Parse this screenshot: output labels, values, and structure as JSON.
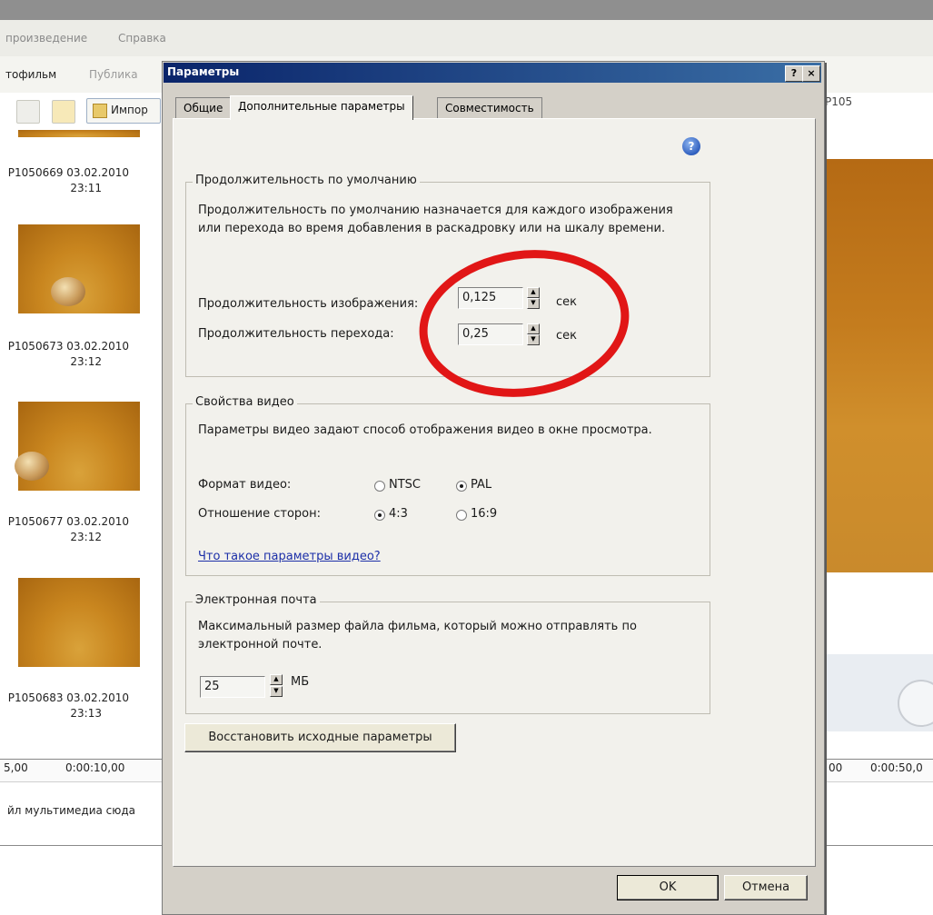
{
  "app": {
    "menu": [
      "произведение",
      "Справка"
    ],
    "toolbar": {
      "movie_label": "тофильм",
      "publish_label": "Публика",
      "import_label": "Импор"
    },
    "collection": [
      {
        "name": "P1050669 03.02.2010",
        "time": "23:11"
      },
      {
        "name": "P1050673 03.02.2010",
        "time": "23:12"
      },
      {
        "name": "P1050677 03.02.2010",
        "time": "23:12"
      },
      {
        "name": "P1050683 03.02.2010",
        "time": "23:13"
      }
    ],
    "timeline": {
      "left_start": "5,00",
      "left_mark": "0:00:10,00",
      "right_start": "00",
      "right_mark": "0:00:50,0",
      "drop_hint": "йл мультимедиа сюда"
    },
    "preview": {
      "header": "P105"
    }
  },
  "dialog": {
    "title": "Параметры",
    "title_buttons": {
      "help": "?",
      "close": "×"
    },
    "tabs": [
      {
        "label": "Общие",
        "active": false
      },
      {
        "label": "Дополнительные параметры",
        "active": true
      },
      {
        "label": "Совместимость",
        "active": false
      }
    ],
    "help_icon": "question-icon",
    "duration": {
      "legend": "Продолжительность по умолчанию",
      "description": "Продолжительность по умолчанию назначается для каждого изображения или перехода во время добавления в раскадровку или на шкалу времени.",
      "image_label": "Продолжительность изображения:",
      "image_value": "0,125",
      "transition_label": "Продолжительность перехода:",
      "transition_value": "0,25",
      "unit": "сек"
    },
    "video": {
      "legend": "Свойства видео",
      "description": "Параметры видео задают способ отображения видео в окне просмотра.",
      "format_label": "Формат видео:",
      "format_options": [
        {
          "label": "NTSC",
          "selected": false
        },
        {
          "label": "PAL",
          "selected": true
        }
      ],
      "aspect_label": "Отношение сторон:",
      "aspect_options": [
        {
          "label": "4:3",
          "selected": true
        },
        {
          "label": "16:9",
          "selected": false
        }
      ],
      "help_link": "Что такое параметры видео?"
    },
    "email": {
      "legend": "Электронная почта",
      "description": "Максимальный размер файла фильма, который можно отправлять по электронной почте.",
      "size_value": "25",
      "unit": "МБ"
    },
    "restore_button": "Восстановить исходные параметры",
    "ok_button": "OK",
    "cancel_button": "Отмена"
  },
  "colors": {
    "titlebar": "#0a246a",
    "annotation": "#e11616",
    "dialog_face": "#d4d0c8",
    "link": "#1c2fa8"
  }
}
